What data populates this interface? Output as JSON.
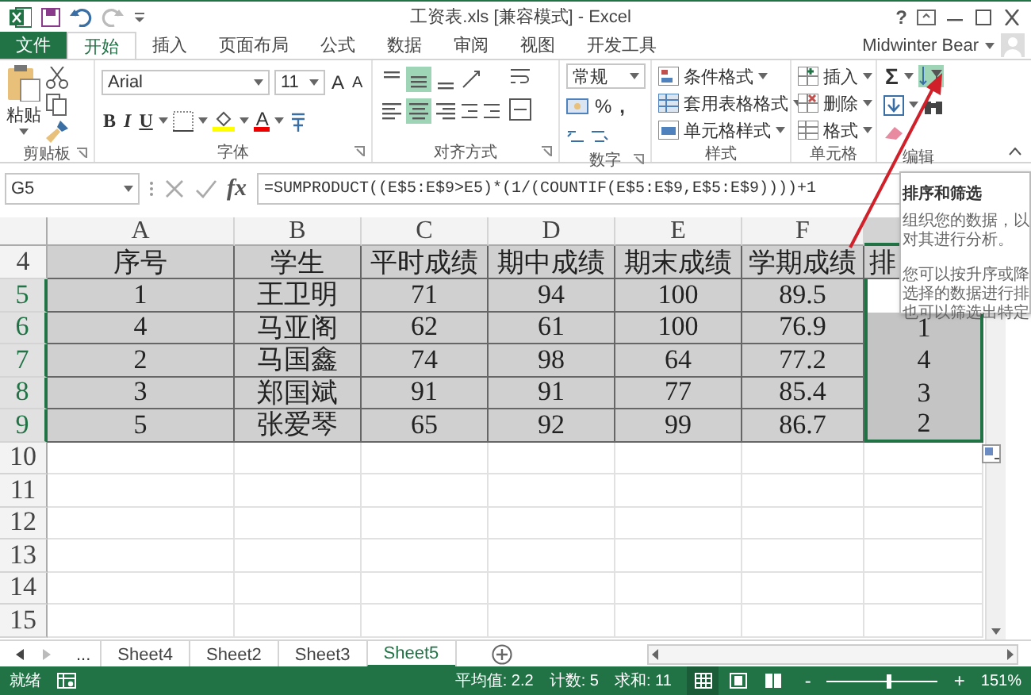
{
  "window": {
    "title": "工资表.xls [兼容模式] - Excel",
    "help": "?"
  },
  "ribbon_tabs": [
    {
      "label": "文件",
      "kind": "file"
    },
    {
      "label": "开始",
      "kind": "tab",
      "selected": true
    },
    {
      "label": "插入",
      "kind": "tab",
      "selected": false
    },
    {
      "label": "页面布局",
      "kind": "tab",
      "selected": false
    },
    {
      "label": "公式",
      "kind": "tab",
      "selected": false
    },
    {
      "label": "数据",
      "kind": "tab",
      "selected": false
    },
    {
      "label": "审阅",
      "kind": "tab",
      "selected": false
    },
    {
      "label": "视图",
      "kind": "tab",
      "selected": false
    },
    {
      "label": "开发工具",
      "kind": "tab",
      "selected": false
    }
  ],
  "account": {
    "name": "Midwinter Bear"
  },
  "clipboard": {
    "label": "剪贴板",
    "paste": "粘贴"
  },
  "font": {
    "label": "字体",
    "name": "Arial",
    "size": "11",
    "grow": "A",
    "shrink": "A",
    "bold": "B",
    "italic": "I",
    "underline": "U",
    "font_color": "A"
  },
  "alignment": {
    "label": "对齐方式",
    "buttons": [
      {
        "kind": "top",
        "selected": false
      },
      {
        "kind": "middle",
        "selected": true
      },
      {
        "kind": "bottom",
        "selected": false
      },
      {
        "kind": "left",
        "selected": false
      },
      {
        "kind": "center",
        "selected": true
      },
      {
        "kind": "right",
        "selected": false
      }
    ]
  },
  "number": {
    "label": "数字",
    "format": "常规",
    "percent": "%",
    "comma": ","
  },
  "styles": {
    "label": "样式",
    "items": [
      "条件格式",
      "套用表格格式",
      "单元格样式"
    ]
  },
  "cells": {
    "label": "单元格",
    "items": [
      "插入",
      "删除",
      "格式"
    ]
  },
  "editing": {
    "label": "编辑",
    "sum": "Σ"
  },
  "formula_bar": {
    "name_box": "G5",
    "fx": "fx",
    "formula": "=SUMPRODUCT((E$5:E$9>E5)*(1/(COUNTIF(E$5:E$9,E$5:E$9))))+1"
  },
  "sheet": {
    "columns": [
      {
        "letter": "A",
        "selected": false
      },
      {
        "letter": "B",
        "selected": false
      },
      {
        "letter": "C",
        "selected": false
      },
      {
        "letter": "D",
        "selected": false
      },
      {
        "letter": "E",
        "selected": false
      },
      {
        "letter": "F",
        "selected": false
      },
      {
        "selected": true
      }
    ],
    "rows": [
      {
        "number": "4",
        "selected": false,
        "cells": [
          "序号",
          "学生",
          "平时成绩",
          "期中成绩",
          "期末成绩",
          "学期成绩"
        ],
        "rank": {
          "text": "排",
          "selected": false
        }
      },
      {
        "number": "5",
        "selected": true,
        "cells": [
          "1",
          "王卫明",
          "71",
          "94",
          "100",
          "89.5"
        ],
        "rank": {
          "selected": true,
          "active": true
        }
      },
      {
        "number": "6",
        "selected": true,
        "cells": [
          "4",
          "马亚阁",
          "62",
          "61",
          "100",
          "76.9"
        ],
        "rank": {
          "text": "1",
          "selected": true
        }
      },
      {
        "number": "7",
        "selected": true,
        "cells": [
          "2",
          "马国鑫",
          "74",
          "98",
          "64",
          "77.2"
        ],
        "rank": {
          "text": "4",
          "selected": true
        }
      },
      {
        "number": "8",
        "selected": true,
        "cells": [
          "3",
          "郑国斌",
          "91",
          "91",
          "77",
          "85.4"
        ],
        "rank": {
          "text": "3",
          "selected": true
        }
      },
      {
        "number": "9",
        "selected": true,
        "cells": [
          "5",
          "张爱琴",
          "65",
          "92",
          "99",
          "86.7"
        ],
        "rank": {
          "text": "2",
          "selected": true
        }
      },
      {
        "number": "10",
        "selected": false
      },
      {
        "number": "11",
        "selected": false
      },
      {
        "number": "12",
        "selected": false
      },
      {
        "number": "13",
        "selected": false
      },
      {
        "number": "14",
        "selected": false
      },
      {
        "number": "15",
        "selected": false
      }
    ]
  },
  "tooltip": {
    "title": "排序和筛选",
    "paragraphs": [
      [
        "组织您的数据，以",
        "对其进行分析。"
      ],
      [
        "您可以按升序或降",
        "选择的数据进行排",
        "也可以筛选出特定"
      ]
    ]
  },
  "sheet_tabs": {
    "more": "...",
    "tabs": [
      {
        "label": "Sheet4",
        "selected": false
      },
      {
        "label": "Sheet2",
        "selected": false
      },
      {
        "label": "Sheet3",
        "selected": false
      },
      {
        "label": "Sheet5",
        "selected": true
      }
    ]
  },
  "status_bar": {
    "mode": "就绪",
    "average": "平均值: 2.2",
    "count": "计数: 5",
    "sum": "求和: 11",
    "views": [
      {
        "kind": "normal",
        "selected": true
      },
      {
        "kind": "page_layout",
        "selected": false
      },
      {
        "kind": "page_break",
        "selected": false
      }
    ],
    "zoom_out": "-",
    "zoom_slider": {
      "level": 0.55
    },
    "zoom_in": "+",
    "zoom": "151%"
  }
}
